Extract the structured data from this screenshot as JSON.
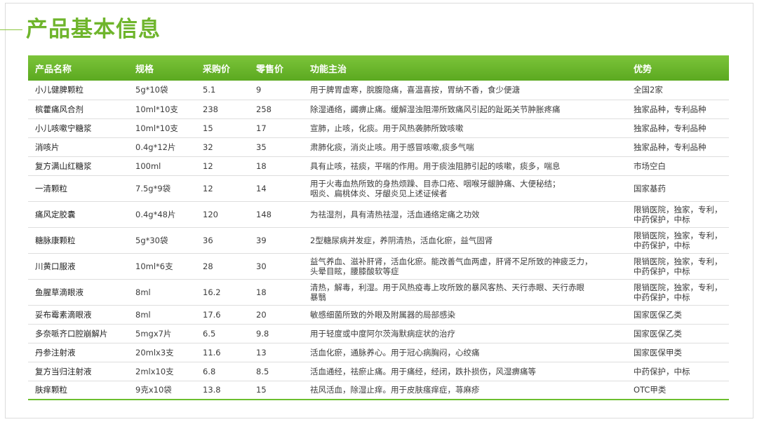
{
  "title": "产品基本信息",
  "colors": {
    "title": "#6fb52c",
    "header_bg": "#6ab531",
    "bottom_rule": "#6cbf2e"
  },
  "table": {
    "headers": [
      "产品名称",
      "规格",
      "采购价",
      "零售价",
      "功能主治",
      "优势"
    ],
    "rows": [
      [
        "小儿健脾颗粒",
        "5g*10袋",
        "5.1",
        "9",
        "用于脾胃虚寒，脘腹隐痛，喜温喜按，胃纳不香，食少便溏",
        "全国2家"
      ],
      [
        "槟藿痛风合剂",
        "10ml*10支",
        "238",
        "258",
        "除湿通络，蠲痹止痛。缓解湿浊阻滞所致痛风引起的趾跖关节肿胀疼痛",
        "独家品种，专利品种"
      ],
      [
        "小儿咳嗽宁糖浆",
        "10ml*10支",
        "15",
        "17",
        "宣肺，止咳，化痰。用于风热袭肺所致咳嗽",
        "独家品种，专利品种"
      ],
      [
        "消咳片",
        "0.4g*12片",
        "32",
        "35",
        " 肃肺化痰，消炎止咳。用于感冒咳嗽,痰多气喘",
        "独家品种，专利品种"
      ],
      [
        "复方满山红糖浆",
        "100ml",
        "12",
        "18",
        "具有止咳，祛痰，平喘的作用。用于痰浊阻肺引起的咳嗽，痰多，喘息",
        "市场空白"
      ],
      [
        "一清颗粒",
        "7.5g*9袋",
        "12",
        "14",
        "用于火毒血热所致的身热烦躁、目赤口疮、咽喉牙龈肿痛、大便秘结；\n咽炎、扁桃体炎、牙龈炎见上述证候者",
        "国家基药"
      ],
      [
        "痛风定胶囊",
        "0.4g*48片",
        "120",
        "148",
        "为祛湿剂，具有清热祛湿，活血通络定痛之功效",
        "限销医院，独家，专利，\n中药保护，中标"
      ],
      [
        "糖脉康颗粒",
        "5g*30袋",
        "36",
        "39",
        "2型糖尿病并发症，养阴清热，活血化瘀，益气固肾",
        "限销医院，独家，专利，\n中药保护，中标"
      ],
      [
        "川黄口服液",
        "10ml*6支",
        "28",
        "30",
        "益气养血、滋补肝肾，活血化瘀。能改善气血两虚，肝肾不足所致的神疲乏力，\n头晕目眩，腰膝酸软等症",
        "限销医院，独家，专利，\n中药保护，中标"
      ],
      [
        "鱼腥草滴眼液",
        "8ml",
        "16.2",
        "18",
        "清热，解毒，利湿。用于风热疫毒上攻所致的暴风客热、天行赤眼、天行赤眼\n暴翳",
        "限销医院，独家，专利，\n中药保护，中标"
      ],
      [
        "妥布霉素滴眼液",
        "8ml",
        "17.6",
        "20",
        "敏感细菌所致的外眼及附属器的局部感染",
        "国家医保乙类"
      ],
      [
        "多奈哌齐口腔崩解片",
        "5mgx7片",
        "6.5",
        "9.8",
        "用于轻度或中度阿尔茨海默病症状的治疗",
        "国家医保乙类"
      ],
      [
        "丹参注射液",
        "20mlx3支",
        "11.6",
        "13",
        "活血化瘀，通脉养心。用于冠心病胸闷，心绞痛",
        "国家医保甲类"
      ],
      [
        "复方当归注射液",
        "2mlx10支",
        "6.8",
        "8.5",
        "活血通经，祛瘀止痛。用于痛经，经闭，跌扑损伤，风湿痹痛等",
        "中药保护，中标"
      ],
      [
        "肤痒颗粒",
        "9克x10袋",
        "13.8",
        "15",
        "祛风活血，除湿止痒。用于皮肤瘙痒症，荨麻疹",
        "OTC甲类"
      ]
    ]
  }
}
